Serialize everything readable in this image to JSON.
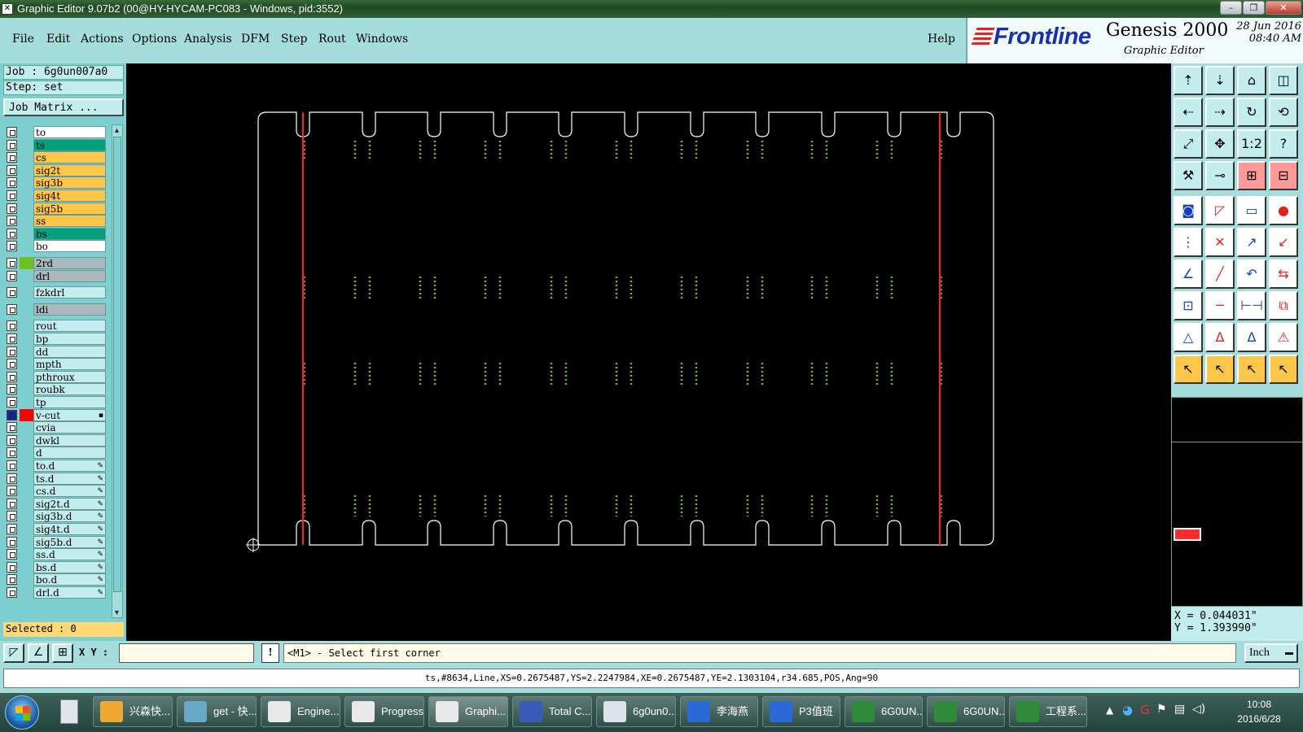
{
  "window": {
    "title": "Graphic Editor 9.07b2 (00@HY-HYCAM-PC083 - Windows, pid:3552)",
    "icon": "x-app-icon",
    "buttons": [
      "–",
      "❐",
      "✕"
    ]
  },
  "menu": {
    "items": [
      "File",
      "Edit",
      "Actions",
      "Options",
      "Analysis",
      "DFM",
      "Step",
      "Rout",
      "Windows"
    ],
    "help": "Help"
  },
  "brand": {
    "logo": "Frontline",
    "product": "Genesis 2000",
    "subtitle": "Graphic Editor",
    "date": "28 Jun 2016",
    "time": "08:40 AM"
  },
  "job": {
    "job_label": "Job : 6g0un007a0",
    "step_label": "Step: set",
    "matrix_button": "Job Matrix ...",
    "selected_label": "Selected : 0"
  },
  "colors": {
    "yellow": "#ffc64a",
    "green": "#00a27d",
    "white": "#ffffff",
    "gray": "#a9b9bd",
    "cyan": "#c3ecec",
    "red": "#ff0000",
    "lime": "#6cc21c"
  },
  "layers": [
    {
      "name": "to",
      "fill": "white",
      "swatch": "",
      "mark": ""
    },
    {
      "name": "ts",
      "fill": "green",
      "swatch": "",
      "mark": ""
    },
    {
      "name": "cs",
      "fill": "yellow",
      "swatch": "",
      "mark": ""
    },
    {
      "name": "sig2t",
      "fill": "yellow",
      "swatch": "",
      "mark": ""
    },
    {
      "name": "sig3b",
      "fill": "yellow",
      "swatch": "",
      "mark": ""
    },
    {
      "name": "sig4t",
      "fill": "yellow",
      "swatch": "",
      "mark": ""
    },
    {
      "name": "sig5b",
      "fill": "yellow",
      "swatch": "",
      "mark": ""
    },
    {
      "name": "ss",
      "fill": "yellow",
      "swatch": "",
      "mark": ""
    },
    {
      "name": "bs",
      "fill": "green",
      "swatch": "",
      "mark": ""
    },
    {
      "name": "bo",
      "fill": "white",
      "swatch": "",
      "mark": ""
    },
    {
      "name": "2rd",
      "fill": "gray",
      "swatch": "lime",
      "mark": ""
    },
    {
      "name": "drl",
      "fill": "gray",
      "swatch": "",
      "mark": ""
    },
    {
      "name": "fzkdrl",
      "fill": "cyan",
      "swatch": "",
      "mark": ""
    },
    {
      "name": "ldi",
      "fill": "gray",
      "swatch": "",
      "mark": ""
    },
    {
      "name": "rout",
      "fill": "cyan",
      "swatch": "",
      "mark": ""
    },
    {
      "name": "bp",
      "fill": "cyan",
      "swatch": "",
      "mark": ""
    },
    {
      "name": "dd",
      "fill": "cyan",
      "swatch": "",
      "mark": ""
    },
    {
      "name": "mpth",
      "fill": "cyan",
      "swatch": "",
      "mark": ""
    },
    {
      "name": "pthroux",
      "fill": "cyan",
      "swatch": "",
      "mark": ""
    },
    {
      "name": "roubk",
      "fill": "cyan",
      "swatch": "",
      "mark": ""
    },
    {
      "name": "tp",
      "fill": "cyan",
      "swatch": "",
      "mark": ""
    },
    {
      "name": "v-cut",
      "fill": "cyan",
      "swatch": "red",
      "mark": "▪",
      "active": true
    },
    {
      "name": "cvia",
      "fill": "cyan",
      "swatch": "",
      "mark": ""
    },
    {
      "name": "dwkl",
      "fill": "cyan",
      "swatch": "",
      "mark": ""
    },
    {
      "name": "d",
      "fill": "cyan",
      "swatch": "",
      "mark": ""
    },
    {
      "name": "to.d",
      "fill": "cyan",
      "swatch": "",
      "mark": "✎"
    },
    {
      "name": "ts.d",
      "fill": "cyan",
      "swatch": "",
      "mark": "✎"
    },
    {
      "name": "cs.d",
      "fill": "cyan",
      "swatch": "",
      "mark": "✎"
    },
    {
      "name": "sig2t.d",
      "fill": "cyan",
      "swatch": "",
      "mark": "✎"
    },
    {
      "name": "sig3b.d",
      "fill": "cyan",
      "swatch": "",
      "mark": "✎"
    },
    {
      "name": "sig4t.d",
      "fill": "cyan",
      "swatch": "",
      "mark": "✎"
    },
    {
      "name": "sig5b.d",
      "fill": "cyan",
      "swatch": "",
      "mark": "✎"
    },
    {
      "name": "ss.d",
      "fill": "cyan",
      "swatch": "",
      "mark": "✎"
    },
    {
      "name": "bs.d",
      "fill": "cyan",
      "swatch": "",
      "mark": "✎"
    },
    {
      "name": "bo.d",
      "fill": "cyan",
      "swatch": "",
      "mark": "✎"
    },
    {
      "name": "drl.d",
      "fill": "cyan",
      "swatch": "",
      "mark": "✎"
    }
  ],
  "toolbar_icons": [
    "pan-up-icon",
    "pan-down-icon",
    "home-icon",
    "split-view-icon",
    "pan-left-icon",
    "pan-right-icon",
    "rotate-icon",
    "redraw-icon",
    "zoom-fit-icon",
    "zoom-in-icon",
    "one-to-one-icon",
    "help-icon",
    "tools-icon",
    "measure-line-icon",
    "snap-grid-icon",
    "snap-options-icon",
    "select-pad-icon",
    "select-window-icon",
    "ruler-icon",
    "pad-icon",
    "connect-icon",
    "cross-icon",
    "point-to-point-icon",
    "segment-icon",
    "edit-line-icon",
    "add-line-icon",
    "arc-icon",
    "flip-icon",
    "move-node-icon",
    "line-icon",
    "dimension-icon",
    "copy-icon",
    "triangle-icon",
    "triangle-alt-icon",
    "triangle-outline-icon",
    "triangle-cut-icon",
    "pointer-icon",
    "pointer-box-icon",
    "pointer-circle-icon",
    "pointer-move-icon"
  ],
  "toolbar_glyphs": [
    "⇡",
    "⇣",
    "⌂",
    "◫",
    "⇠",
    "⇢",
    "↻",
    "⟲",
    "⤢",
    "✥",
    "1:2",
    "?",
    "⚒",
    "⊸",
    "⊞",
    "⊟",
    "◙",
    "◸",
    "▭",
    "●",
    "⋮",
    "✕",
    "↗",
    "↙",
    "∠",
    "╱",
    "↶",
    "⇆",
    "⊡",
    "─",
    "⊢⊣",
    "⧉",
    "△",
    "Δ",
    "Δ",
    "⚠",
    "↖",
    "↖",
    "↖",
    "↖"
  ],
  "coordinates": {
    "x": "X = 0.044031\"",
    "y": "Y = 1.393990\""
  },
  "command": {
    "xy_label": "X Y :",
    "xy_value": "",
    "prompt": "<M1> - Select first corner",
    "units": "Inch"
  },
  "status_line": "ts,#8634,Line,XS=0.2675487,YS=2.2247984,XE=0.2675487,YE=2.1303104,r34.685,POS,Ang=90",
  "taskbar": {
    "tasks": [
      "兴森快...",
      "get - 快...",
      "Engine...",
      "Progress",
      "Graphi...",
      "Total C...",
      "6g0un0...",
      "李海燕",
      "P3值班",
      "6G0UN...",
      "6G0UN...",
      "工程系..."
    ],
    "time": "10:08",
    "date": "2016/6/28"
  }
}
